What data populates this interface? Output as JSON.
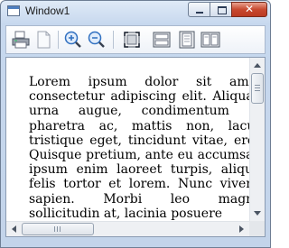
{
  "window": {
    "title": "Window1",
    "controls": {
      "minimize": "minimize",
      "maximize": "maximize",
      "close": "✕"
    }
  },
  "toolbar": {
    "buttons": [
      {
        "name": "print-icon"
      },
      {
        "name": "copy-icon"
      },
      {
        "name": "zoom-in-icon"
      },
      {
        "name": "zoom-out-icon"
      },
      {
        "name": "actual-size-icon"
      },
      {
        "name": "page-width-icon"
      },
      {
        "name": "whole-page-icon"
      },
      {
        "name": "two-pages-icon"
      }
    ]
  },
  "document": {
    "text": "Lorem ipsum dolor sit amet, consectetur adipiscing elit. Aliquam urna augue, condimentum et, pharetra ac, mattis non, lacus, tristique eget, tincidunt vitae, eros. Quisque pretium, ante eu accumsan, ipsum enim laoreet turpis, aliquet felis tortor et lorem. Nunc viverra sapien. Morbi leo magna, sollicitudin at, lacinia posuere"
  },
  "colors": {
    "window_frame": "#c7d8ee",
    "close_button": "#c8492f",
    "accent": "#2f6fc0"
  }
}
